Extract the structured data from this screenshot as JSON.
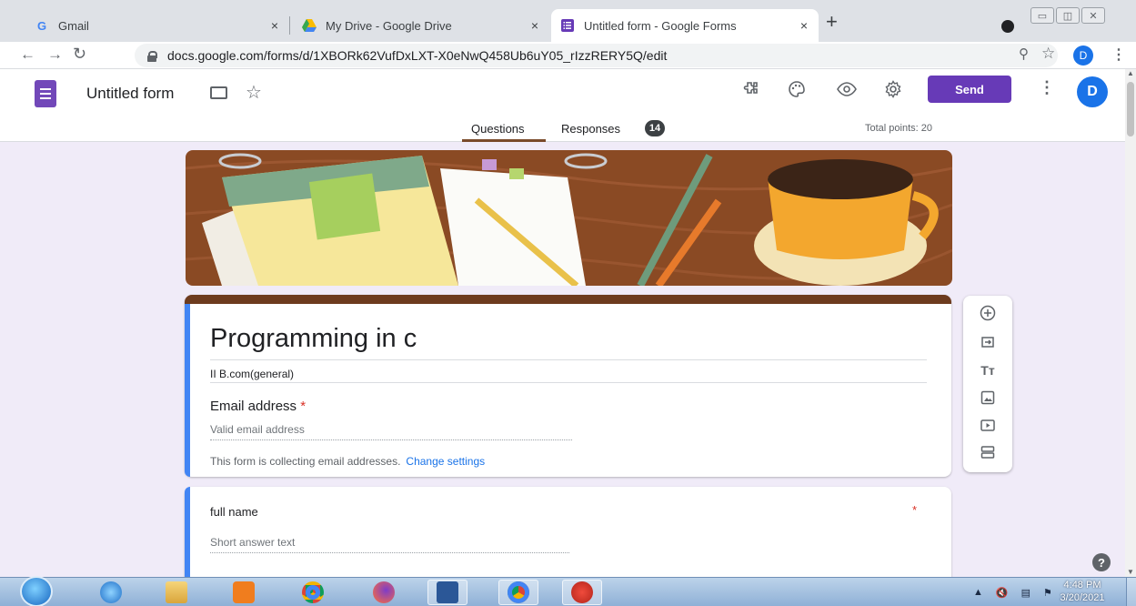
{
  "browser": {
    "tabs": [
      {
        "label": "Gmail",
        "close": "×"
      },
      {
        "label": "My Drive - Google Drive",
        "close": "×"
      },
      {
        "label": "Untitled form - Google Forms",
        "close": "×"
      }
    ],
    "new_tab": "+",
    "url": "docs.google.com/forms/d/1XBORk62VufDxLXT-X0eNwQ458Ub6uY05_rIzzRERY5Q/edit",
    "profile_initial": "D"
  },
  "forms_header": {
    "doc_title": "Untitled form",
    "send_label": "Send",
    "avatar_initial": "D",
    "tabs": {
      "questions": "Questions",
      "responses": "Responses"
    },
    "responses_count": "14",
    "total_points": "Total points: 20"
  },
  "form": {
    "title": "Programming in c",
    "description": "II B.com(general)",
    "email_label": "Email address",
    "required_mark": "*",
    "email_placeholder": "Valid email address",
    "collecting_note": "This form is collecting email addresses.",
    "change_settings": "Change settings",
    "questions": [
      {
        "title": "full name",
        "placeholder": "Short answer text",
        "required_mark": "*"
      }
    ]
  },
  "side_tools": [
    "add-question-icon",
    "import-questions-icon",
    "add-title-icon",
    "add-image-icon",
    "add-video-icon",
    "add-section-icon"
  ],
  "taskbar": {
    "time": "4:48 PM",
    "date": "3/20/2021"
  },
  "colors": {
    "form_accent": "#673ab7",
    "header_band": "#6d3b1e",
    "question_bar": "#4285f4",
    "background": "#f0ebf8"
  }
}
